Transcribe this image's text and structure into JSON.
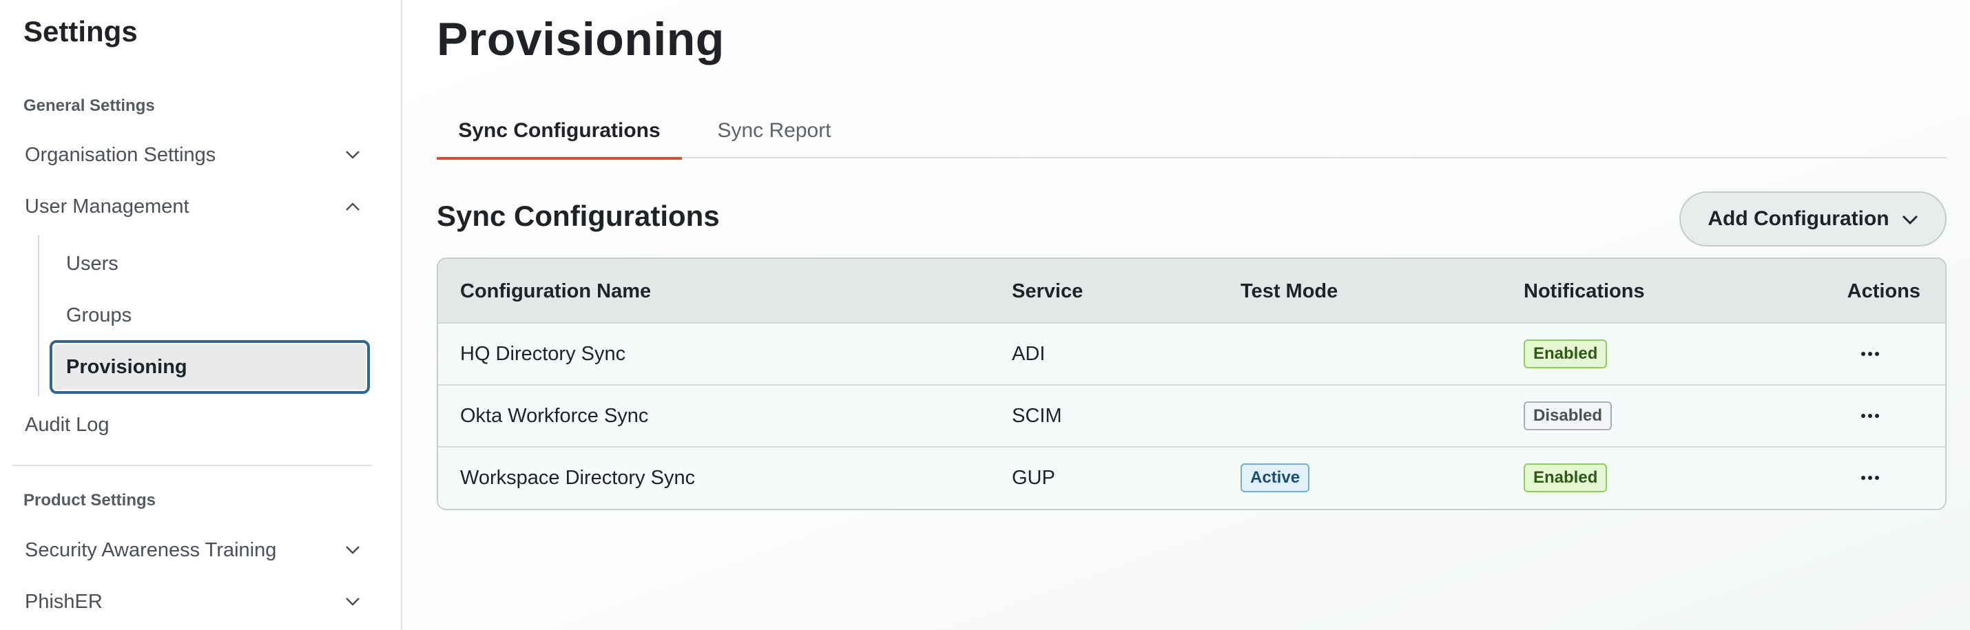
{
  "sidebar": {
    "title": "Settings",
    "general_section": "General Settings",
    "product_section": "Product Settings",
    "items": {
      "organisation": {
        "label": "Organisation Settings",
        "icon": "chevron-down-icon"
      },
      "user_management": {
        "label": "User Management",
        "icon": "chevron-up-icon"
      },
      "audit_log": {
        "label": "Audit Log"
      },
      "security_awareness": {
        "label": "Security Awareness Training",
        "icon": "chevron-down-icon"
      },
      "phisher": {
        "label": "PhishER",
        "icon": "chevron-down-icon"
      }
    },
    "sub_items": {
      "users": "Users",
      "groups": "Groups",
      "provisioning": "Provisioning"
    }
  },
  "main": {
    "title": "Provisioning",
    "tabs": [
      {
        "label": "Sync Configurations",
        "active": true
      },
      {
        "label": "Sync Report",
        "active": false
      }
    ],
    "section_title": "Sync Configurations",
    "add_button": {
      "label": "Add Configuration",
      "icon": "chevron-down-icon"
    }
  },
  "table": {
    "columns": {
      "name": "Configuration Name",
      "service": "Service",
      "test_mode": "Test Mode",
      "notifications": "Notifications",
      "actions": "Actions"
    },
    "rows": [
      {
        "name": "HQ Directory Sync",
        "service": "ADI",
        "test_mode": "",
        "notifications": "Enabled"
      },
      {
        "name": "Okta Workforce Sync",
        "service": "SCIM",
        "test_mode": "",
        "notifications": "Disabled"
      },
      {
        "name": "Workspace Directory Sync",
        "service": "GUP",
        "test_mode": "Active",
        "notifications": "Enabled"
      }
    ]
  },
  "colors": {
    "accent_tab_underline": "#e0492b",
    "focus_ring": "#2f6690",
    "enabled_badge": "#e6f7d4",
    "active_badge": "#e3f1fa"
  }
}
